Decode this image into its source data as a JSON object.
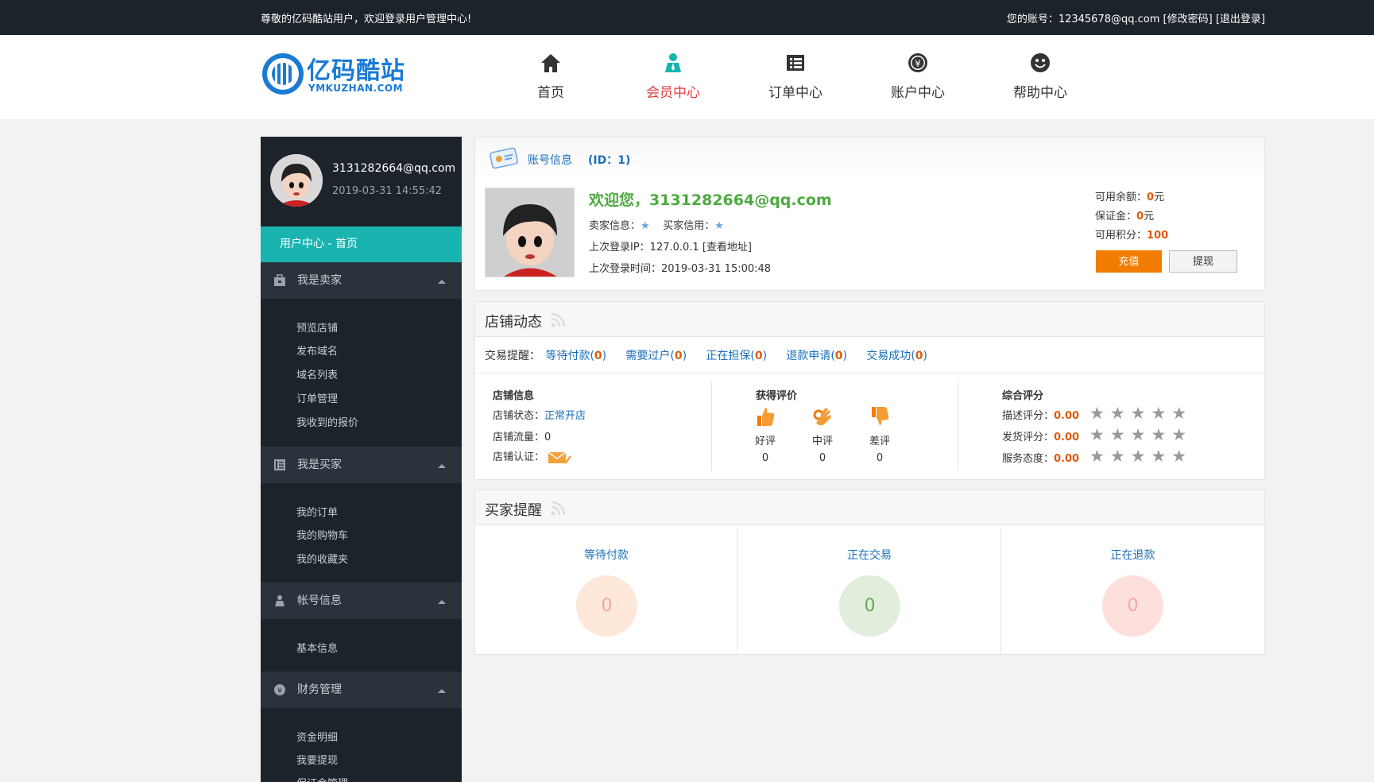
{
  "topbar": {
    "welcome": "尊敬的亿码酷站用户，欢迎登录用户管理中心!",
    "account_label": "您的账号：12345678@qq.com",
    "change_password": "[修改密码]",
    "logout": "[退出登录]"
  },
  "logo": {
    "cn": "亿码酷站",
    "en": "YMKUZHAN.COM"
  },
  "nav": [
    {
      "label": "首页",
      "icon": "home-icon"
    },
    {
      "label": "会员中心",
      "icon": "member-icon",
      "active": true
    },
    {
      "label": "订单中心",
      "icon": "order-icon"
    },
    {
      "label": "账户中心",
      "icon": "yen-icon"
    },
    {
      "label": "帮助中心",
      "icon": "smile-icon"
    }
  ],
  "sidebar": {
    "email": "3131282664@qq.com",
    "time": "2019-03-31 14:55:42",
    "active": "用户中心 - 首页",
    "groups": [
      {
        "title": "我是卖家",
        "items": [
          "预览店铺",
          "发布域名",
          "域名列表",
          "订单管理",
          "我收到的报价"
        ]
      },
      {
        "title": "我是买家",
        "items": [
          "我的订单",
          "我的购物车",
          "我的收藏夹"
        ]
      },
      {
        "title": "帐号信息",
        "items": [
          "基本信息"
        ]
      },
      {
        "title": "财务管理",
        "items": [
          "资金明细",
          "我要提现",
          "保证金管理"
        ]
      }
    ]
  },
  "account": {
    "title": "账号信息",
    "id_text": "(ID：1)",
    "welcome": "欢迎您，3131282664@qq.com",
    "seller_info": "卖家信息：",
    "buyer_credit": "买家信用：",
    "last_ip": "上次登录IP：127.0.0.1 [查看地址]",
    "last_time": "上次登录时间：2019-03-31 15:00:48",
    "balance_label": "可用余额：",
    "balance_value": "0",
    "deposit_label": "保证金：",
    "deposit_value": "0",
    "yuan": "元",
    "points_label": "可用积分：",
    "points_value": "100",
    "recharge": "充值",
    "withdraw": "提现"
  },
  "shop": {
    "title": "店铺动态",
    "reminder_label": "交易提醒：",
    "reminders": [
      {
        "label": "等待付款",
        "count": "0"
      },
      {
        "label": "需要过户",
        "count": "0"
      },
      {
        "label": "正在担保",
        "count": "0"
      },
      {
        "label": "退款申请",
        "count": "0"
      },
      {
        "label": "交易成功",
        "count": "0"
      }
    ],
    "info_title": "店铺信息",
    "status_label": "店铺状态：",
    "status_value": "正常开店",
    "traffic": "店铺流量：0",
    "cert_label": "店铺认证：",
    "eval_title": "获得评价",
    "evals": [
      {
        "label": "好评",
        "value": "0",
        "icon": "thumbs-up-icon"
      },
      {
        "label": "中评",
        "value": "0",
        "icon": "ok-hand-icon"
      },
      {
        "label": "差评",
        "value": "0",
        "icon": "thumbs-down-icon"
      }
    ],
    "score_title": "综合评分",
    "scores": [
      {
        "label": "描述评分：",
        "value": "0.00"
      },
      {
        "label": "发货评分：",
        "value": "0.00"
      },
      {
        "label": "服务态度：",
        "value": "0.00"
      }
    ]
  },
  "buyer": {
    "title": "买家提醒",
    "cells": [
      {
        "label": "等待付款",
        "value": "0",
        "bg": "#fde8d9",
        "fg": "#f3a6a6"
      },
      {
        "label": "正在交易",
        "value": "0",
        "bg": "#e2eedd",
        "fg": "#6aa84f"
      },
      {
        "label": "正在退款",
        "value": "0",
        "bg": "#fde0dc",
        "fg": "#f3a6a6"
      }
    ]
  }
}
